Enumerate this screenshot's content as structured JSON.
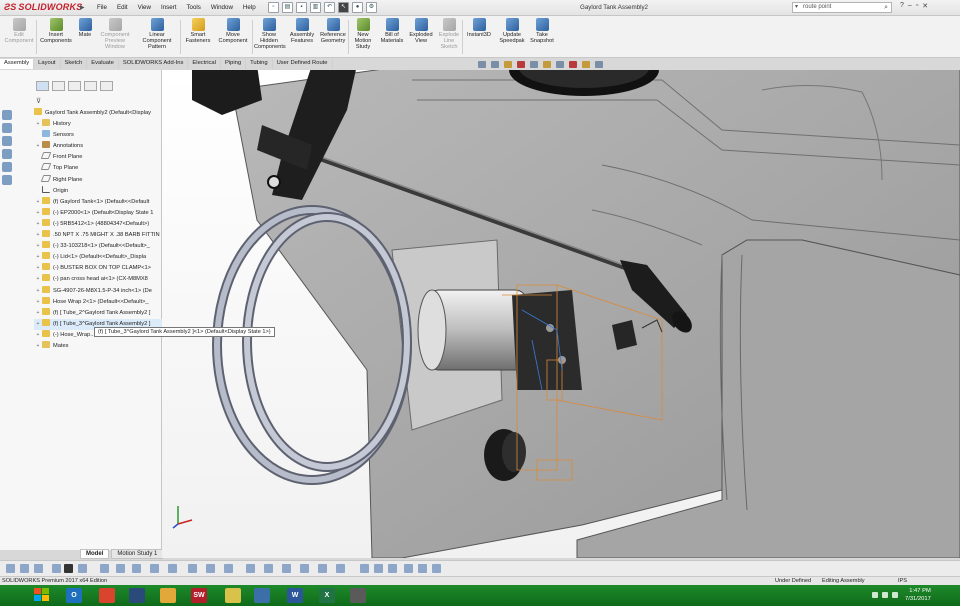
{
  "app": {
    "logo": "SOLIDWORKS",
    "document_title": "Gaylord Tank Assembly2",
    "menu": [
      "File",
      "Edit",
      "View",
      "Insert",
      "Tools",
      "Window",
      "Help"
    ],
    "search_value": "route point"
  },
  "ribbon": {
    "buttons": [
      {
        "label": "Edit Component",
        "disabled": true
      },
      {
        "label": "Insert Components",
        "disabled": false
      },
      {
        "label": "Mate",
        "disabled": false
      },
      {
        "label": "Component Preview Window",
        "disabled": true
      },
      {
        "label": "Linear Component Pattern",
        "disabled": false
      },
      {
        "label": "Smart Fasteners",
        "disabled": false
      },
      {
        "label": "Move Component",
        "disabled": false
      },
      {
        "label": "Show Hidden Components",
        "disabled": false
      },
      {
        "label": "Assembly Features",
        "disabled": false
      },
      {
        "label": "Reference Geometry",
        "disabled": false
      },
      {
        "label": "New Motion Study",
        "disabled": false
      },
      {
        "label": "Bill of Materials",
        "disabled": false
      },
      {
        "label": "Exploded View",
        "disabled": false
      },
      {
        "label": "Explode Line Sketch",
        "disabled": true
      },
      {
        "label": "Instant3D",
        "disabled": false
      },
      {
        "label": "Update Speedpak",
        "disabled": false
      },
      {
        "label": "Take Snapshot",
        "disabled": false
      }
    ]
  },
  "command_tabs": [
    "Assembly",
    "Layout",
    "Sketch",
    "Evaluate",
    "SOLIDWORKS Add-Ins",
    "Electrical",
    "Piping",
    "Tubing",
    "User Defined Route"
  ],
  "tree": {
    "root": "Gaylord Tank Assembly2 (Default<Display",
    "items": [
      {
        "label": "History",
        "icon": "folder",
        "expand": "+"
      },
      {
        "label": "Sensors",
        "icon": "sensor",
        "expand": ""
      },
      {
        "label": "Annotations",
        "icon": "ann",
        "expand": "+"
      },
      {
        "label": "Front Plane",
        "icon": "plane",
        "expand": ""
      },
      {
        "label": "Top Plane",
        "icon": "plane",
        "expand": ""
      },
      {
        "label": "Right Plane",
        "icon": "plane",
        "expand": ""
      },
      {
        "label": "Origin",
        "icon": "orig",
        "expand": ""
      },
      {
        "label": "(f) Gaylord Tank<1> (Default<<Default",
        "icon": "part",
        "expand": "+"
      },
      {
        "label": "(-) EP2000<1> (Default<Display State 1",
        "icon": "part",
        "expand": "+"
      },
      {
        "label": "(-) 5RB5412<1> (48804347<Default>)",
        "icon": "part",
        "expand": "+"
      },
      {
        "label": ".50 NPT X .75 MIGHT X .38 BARB FITTIN",
        "icon": "part",
        "expand": "+"
      },
      {
        "label": "(-) 33-103218<1> (Default<<Default>_",
        "icon": "part",
        "expand": "+"
      },
      {
        "label": "(-) Lid<1> (Default<<Default>_Displa",
        "icon": "part",
        "expand": "+"
      },
      {
        "label": "(-) BUSTER BOX ON TOP CLAMP<1>",
        "icon": "part",
        "expand": "+"
      },
      {
        "label": "(-) pan cross head ai<1> (CX-M8MX8",
        "icon": "part",
        "expand": "+"
      },
      {
        "label": "SG-4907-26-M8X1.5-P-34 inch<1> (De",
        "icon": "part",
        "expand": "+"
      },
      {
        "label": "Hose Wrap 2<1> (Default<<Default>_",
        "icon": "part",
        "expand": "+"
      },
      {
        "label": "(f) [ Tube_2^Gaylord Tank Assembly2 ]",
        "icon": "part",
        "expand": "+"
      },
      {
        "label": "(f) [ Tube_3^Gaylord Tank Assembly2 ]",
        "icon": "part",
        "expand": "+",
        "highlight": true
      },
      {
        "label": "(-) Hose_Wrap...",
        "icon": "part",
        "expand": "+"
      },
      {
        "label": "Mates",
        "icon": "folder",
        "expand": "+"
      }
    ],
    "tooltip": "(f) [ Tube_3^Gaylord Tank Assembly2 ]<1> (Default<Display State 1>)"
  },
  "bottom_tabs": [
    "Model",
    "Motion Study 1"
  ],
  "status": {
    "left": "SOLIDWORKS Premium 2017 x64 Edition",
    "defined": "Under Defined",
    "editing": "Editing Assembly",
    "units": "IPS"
  },
  "taskbar": {
    "apps": [
      {
        "label": "O",
        "color": "#1f6fbf",
        "name": "outlook-icon"
      },
      {
        "label": "",
        "color": "#d9442f",
        "name": "chrome-icon"
      },
      {
        "label": "",
        "color": "#2a4a7a",
        "name": "app-icon"
      },
      {
        "label": "",
        "color": "#e2a93a",
        "name": "file-explorer-icon"
      },
      {
        "label": "SW",
        "color": "#b21e2a",
        "name": "solidworks-icon"
      },
      {
        "label": "",
        "color": "#d8c24a",
        "name": "app-icon"
      },
      {
        "label": "",
        "color": "#3b6fa8",
        "name": "app-icon"
      },
      {
        "label": "W",
        "color": "#2b579a",
        "name": "word-icon"
      },
      {
        "label": "X",
        "color": "#217346",
        "name": "excel-icon"
      },
      {
        "label": "",
        "color": "#5a5a5a",
        "name": "app-icon"
      }
    ],
    "time": "1:47 PM",
    "date": "7/31/2017"
  },
  "colors": {
    "taskbar": "#1a7d26",
    "brand": "#c5202d",
    "selection": "#d98a3a"
  }
}
